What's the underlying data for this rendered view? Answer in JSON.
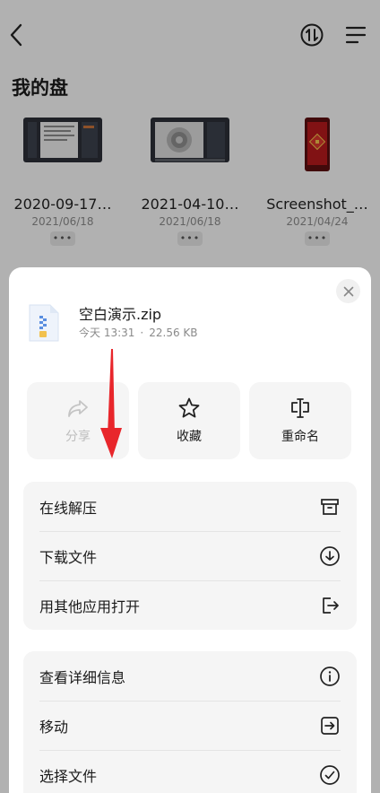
{
  "page": {
    "title": "我的盘"
  },
  "files": [
    {
      "name": "2020-09-17…",
      "date": "2021/06/18",
      "more": "•••"
    },
    {
      "name": "2021-04-10…",
      "date": "2021/06/18",
      "more": "•••"
    },
    {
      "name": "Screenshot_…",
      "date": "2021/04/24",
      "more": "•••"
    }
  ],
  "sheet": {
    "file_name": "空白演示.zip",
    "file_time": "今天 13:31",
    "file_size": "22.56 KB",
    "meta_sep": "·",
    "actions": [
      {
        "label": "分享",
        "icon": "share-icon",
        "enabled": false
      },
      {
        "label": "收藏",
        "icon": "star-icon",
        "enabled": true
      },
      {
        "label": "重命名",
        "icon": "rename-icon",
        "enabled": true
      }
    ],
    "group1": [
      {
        "label": "在线解压",
        "icon": "archive-icon"
      },
      {
        "label": "下载文件",
        "icon": "download-icon"
      },
      {
        "label": "用其他应用打开",
        "icon": "open-with-icon"
      }
    ],
    "group2": [
      {
        "label": "查看详细信息",
        "icon": "info-icon"
      },
      {
        "label": "移动",
        "icon": "move-icon"
      },
      {
        "label": "选择文件",
        "icon": "select-icon"
      }
    ]
  },
  "colors": {
    "annotation_arrow": "#e8262b",
    "accent": "#1a1a1a"
  }
}
